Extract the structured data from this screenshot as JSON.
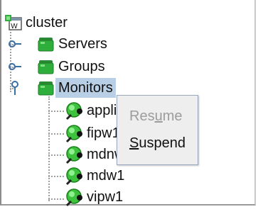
{
  "tree": {
    "root": {
      "label": "cluster",
      "icon": "cluster-icon"
    },
    "items": [
      {
        "label": "Servers",
        "icon": "folder-icon",
        "expanded": false
      },
      {
        "label": "Groups",
        "icon": "folder-icon",
        "expanded": false
      },
      {
        "label": "Monitors",
        "icon": "folder-icon",
        "expanded": true,
        "selected": true
      }
    ],
    "monitors": [
      {
        "label": "appli",
        "icon": "monitor-ok-icon"
      },
      {
        "label": "fipw1",
        "icon": "monitor-ok-icon"
      },
      {
        "label": "mdnw1",
        "icon": "monitor-ok-icon"
      },
      {
        "label": "mdw1",
        "icon": "monitor-ok-icon"
      },
      {
        "label": "vipw1",
        "icon": "monitor-ok-icon"
      }
    ]
  },
  "context_menu": {
    "resume": {
      "prefix": "Res",
      "mnemonic": "u",
      "suffix": "me",
      "enabled": false
    },
    "suspend": {
      "prefix": "",
      "mnemonic": "S",
      "suffix": "uspend",
      "enabled": true
    }
  },
  "colors": {
    "selection": "#b8cfe5",
    "folder_green": "#2eae3a",
    "monitor_green": "#3cc23c",
    "monitor_dot": "#111111",
    "menu_bg": "#eeeeee",
    "disabled_text": "#9c9c9c"
  }
}
